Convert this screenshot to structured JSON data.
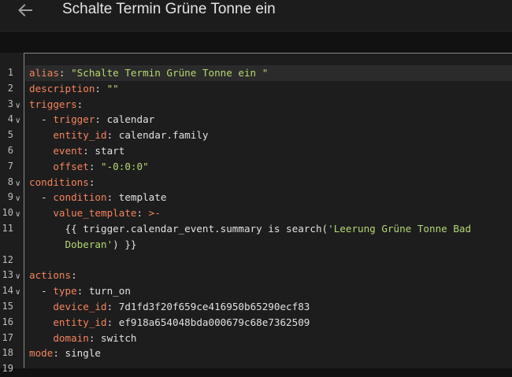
{
  "header": {
    "title": "Schalte Termin Grüne Tonne ein",
    "back_icon": "arrow-left-icon"
  },
  "colors": {
    "key": "#f4845f",
    "string": "#b5d873",
    "plain": "#e0e0e0",
    "background": "#1d1d1d"
  },
  "editor": {
    "lines": [
      {
        "no": "1",
        "fold": "",
        "tokens": [
          {
            "t": "alias",
            "c": "k"
          },
          {
            "t": ": ",
            "c": "p"
          },
          {
            "t": "\"Schalte Termin Grüne Tonne ein \"",
            "c": "s"
          }
        ]
      },
      {
        "no": "2",
        "fold": "",
        "tokens": [
          {
            "t": "description",
            "c": "k"
          },
          {
            "t": ": ",
            "c": "p"
          },
          {
            "t": "\"\"",
            "c": "s"
          }
        ]
      },
      {
        "no": "3",
        "fold": "∨",
        "tokens": [
          {
            "t": "triggers",
            "c": "k"
          },
          {
            "t": ":",
            "c": "p"
          }
        ]
      },
      {
        "no": "4",
        "fold": "∨",
        "tokens": [
          {
            "t": "  - ",
            "c": "p"
          },
          {
            "t": "trigger",
            "c": "k"
          },
          {
            "t": ": calendar",
            "c": "p"
          }
        ]
      },
      {
        "no": "5",
        "fold": "",
        "tokens": [
          {
            "t": "    ",
            "c": "p"
          },
          {
            "t": "entity_id",
            "c": "k"
          },
          {
            "t": ": calendar.family",
            "c": "p"
          }
        ]
      },
      {
        "no": "6",
        "fold": "",
        "tokens": [
          {
            "t": "    ",
            "c": "p"
          },
          {
            "t": "event",
            "c": "k"
          },
          {
            "t": ": start",
            "c": "p"
          }
        ]
      },
      {
        "no": "7",
        "fold": "",
        "tokens": [
          {
            "t": "    ",
            "c": "p"
          },
          {
            "t": "offset",
            "c": "k"
          },
          {
            "t": ": ",
            "c": "p"
          },
          {
            "t": "\"-0:0:0\"",
            "c": "s"
          }
        ]
      },
      {
        "no": "8",
        "fold": "∨",
        "tokens": [
          {
            "t": "conditions",
            "c": "k"
          },
          {
            "t": ":",
            "c": "p"
          }
        ]
      },
      {
        "no": "9",
        "fold": "∨",
        "tokens": [
          {
            "t": "  - ",
            "c": "p"
          },
          {
            "t": "condition",
            "c": "k"
          },
          {
            "t": ": template",
            "c": "p"
          }
        ]
      },
      {
        "no": "10",
        "fold": "∨",
        "tokens": [
          {
            "t": "    ",
            "c": "p"
          },
          {
            "t": "value_template",
            "c": "k"
          },
          {
            "t": ": ",
            "c": "p"
          },
          {
            "t": ">-",
            "c": "k"
          }
        ]
      },
      {
        "no": "11",
        "fold": "",
        "tokens": [
          {
            "t": "      {{ trigger.calendar_event.summary is search(",
            "c": "p"
          },
          {
            "t": "'Leerung Grüne Tonne Bad",
            "c": "s"
          }
        ]
      },
      {
        "no": "",
        "fold": "",
        "tokens": [
          {
            "t": "      ",
            "c": "p"
          },
          {
            "t": "Doberan'",
            "c": "s"
          },
          {
            "t": ") }}",
            "c": "p"
          }
        ]
      },
      {
        "no": "12",
        "fold": "",
        "tokens": [
          {
            "t": "",
            "c": "p"
          }
        ]
      },
      {
        "no": "13",
        "fold": "∨",
        "tokens": [
          {
            "t": "actions",
            "c": "k"
          },
          {
            "t": ":",
            "c": "p"
          }
        ]
      },
      {
        "no": "14",
        "fold": "∨",
        "tokens": [
          {
            "t": "  - ",
            "c": "p"
          },
          {
            "t": "type",
            "c": "k"
          },
          {
            "t": ": turn_on",
            "c": "p"
          }
        ]
      },
      {
        "no": "15",
        "fold": "",
        "tokens": [
          {
            "t": "    ",
            "c": "p"
          },
          {
            "t": "device_id",
            "c": "k"
          },
          {
            "t": ": 7d1fd3f20f659ce416950b65290ecf83",
            "c": "p"
          }
        ]
      },
      {
        "no": "16",
        "fold": "",
        "tokens": [
          {
            "t": "    ",
            "c": "p"
          },
          {
            "t": "entity_id",
            "c": "k"
          },
          {
            "t": ": ef918a654048bda000679c68e7362509",
            "c": "p"
          }
        ]
      },
      {
        "no": "17",
        "fold": "",
        "tokens": [
          {
            "t": "    ",
            "c": "p"
          },
          {
            "t": "domain",
            "c": "k"
          },
          {
            "t": ": switch",
            "c": "p"
          }
        ]
      },
      {
        "no": "18",
        "fold": "",
        "tokens": [
          {
            "t": "mode",
            "c": "k"
          },
          {
            "t": ": single",
            "c": "p"
          }
        ]
      },
      {
        "no": "19",
        "fold": "",
        "tokens": [
          {
            "t": "",
            "c": "p"
          }
        ]
      }
    ]
  }
}
